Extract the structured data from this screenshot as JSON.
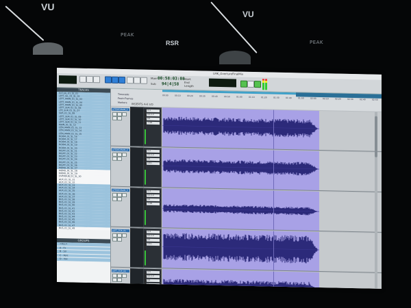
{
  "meters": {
    "left_vu": "VU",
    "right_vu": "VU",
    "center_label": "RSR",
    "peak_left": "PEAK",
    "peak_right": "PEAK"
  },
  "window": {
    "title": "LMK_OvertureFinalMix"
  },
  "transport": {
    "counter_main": "00:58:03:08",
    "counter_sub": "94|4|58",
    "start_label": "Start",
    "end_label": "End",
    "length_label": "Length",
    "main_label": "Main",
    "sub_label": "Sub"
  },
  "tracks_panel": {
    "title": "TRACKS",
    "groups_title": "GROUPS",
    "track_names": [
      "EXT.SIL_01_SL_01",
      "LEFT_SIL_01_SL_02",
      "LEFT_MAIN_01_SL_03",
      "LEFT_MAIN_01_SL_04",
      "LEFT_MAIN_01_SL_05",
      "LEFT_SUR_01_SL_06",
      "LFE_SUR_01_SL_07",
      "SUR_01_SL_08",
      "LEFT_SUR_01_SL_09",
      "LEFT_SUR_01_SL_10",
      "LEFT_SUR_01_SL_11",
      "MAIN_01_SL_12",
      "CEN_MAIN_01_SL_13",
      "CEN_MAIN_01_SL_14",
      "CEN_MAIN_01_SL_15",
      "ROOM_01_SL_16",
      "ROOM_01_SL_17",
      "ROOM_01_SL_18",
      "ROOM_01_SL_19",
      "ROOM_01_SL_20",
      "RIGHT_01_SL_21",
      "RIGHT_01_SL_22",
      "RIGHT_01_SL_23",
      "RIGHT_01_SL_24",
      "RIGHT_01_SL_25",
      "RIGHT_01_SL_26",
      "MONO_01_SL_27",
      "MONO_01_SL_28",
      "MONO_01_SL_29",
      "OVERDUB_01_SL_30",
      "AUX_01_SL_31",
      "AUX_01_SL_32",
      "AUX_01_SL_33",
      "AUX_01_SL_34",
      "AUX_01_SL_35",
      "AUX_01_SL_36",
      "AUX_01_SL_37",
      "BUS_01_SL_38",
      "BUS_01_SL_39",
      "BUS_01_SL_40",
      "BUS_01_SL_41",
      "BUS_01_SL_42",
      "BUS_01_SL_43",
      "BUS_01_SL_44",
      "BUS_01_SL_45",
      "BUS_01_SL_46",
      "BUS_01_SL_47",
      "BUS_01_SL_48"
    ],
    "groups": [
      "<ALL>",
      "A - Fx",
      "B - Str",
      "C - Perc",
      "D - Vox"
    ]
  },
  "rulers": [
    {
      "name": "Timecode"
    },
    {
      "name": "Feet+Frames"
    },
    {
      "name": "Markers"
    }
  ],
  "ruler_ticks": [
    "00:00",
    "00:10",
    "00:20",
    "00:30",
    "00:40",
    "00:50",
    "01:00",
    "01:10",
    "01:20",
    "01:30",
    "01:40",
    "01:50",
    "02:00",
    "02:10",
    "02:20",
    "02:30",
    "02:40",
    "02:50"
  ],
  "io_labels": {
    "insert": "INSERTS A-E",
    "io": "I/O"
  },
  "track_lanes": [
    {
      "name": "LFTDECMAIN_1",
      "input": "In 1",
      "output": "Out 1-2",
      "volume": "0.0",
      "pan": "<100"
    },
    {
      "name": "LFTDECMAIN_2",
      "input": "In 2",
      "output": "Out 1-2",
      "volume": "0.0",
      "pan": "100>"
    },
    {
      "name": "LFTDECMAIN_3",
      "input": "In 3",
      "output": "Out 1-2",
      "volume": "0.0",
      "pan": "<100"
    },
    {
      "name": "LEFT_TOP_01",
      "input": "In 4",
      "output": "Out 1-2",
      "volume": "0.0",
      "pan": "100>"
    },
    {
      "name": "LEFT_TOP_02",
      "input": "In 5",
      "output": "Out 1-2",
      "volume": "0.0",
      "pan": "0"
    }
  ],
  "colors": {
    "waveform_bg": "#a8a1e6",
    "waveform": "#2c2a7a",
    "selection": "#9bc3dd",
    "accent": "#2d6fb0"
  }
}
